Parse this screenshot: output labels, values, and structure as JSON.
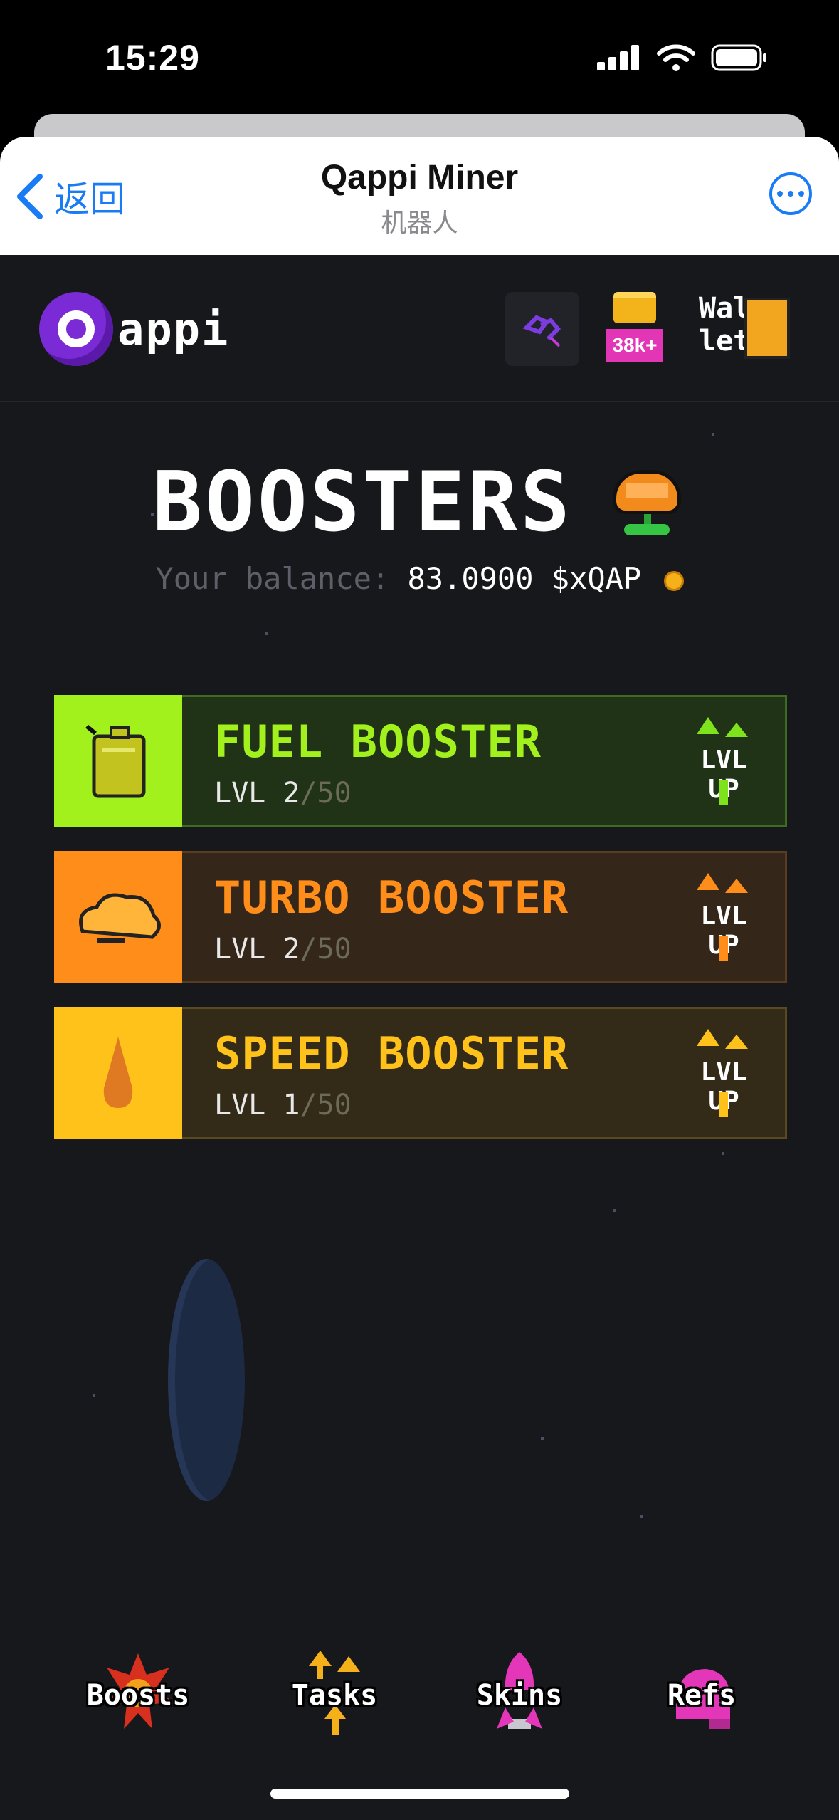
{
  "status_bar": {
    "time": "15:29"
  },
  "telegram_header": {
    "back_label": "返回",
    "title": "Qappi Miner",
    "subtitle": "机器人"
  },
  "app_bar": {
    "logo_text": "appi",
    "pot_badge": "38k+",
    "wallet_label_line1": "Wal",
    "wallet_label_line2": "let"
  },
  "page": {
    "title": "BOOSTERS",
    "balance_label": "Your balance:",
    "balance_value": "83.0900 $xQAP"
  },
  "boosters": [
    {
      "name": "FUEL BOOSTER",
      "lvl_prefix": "LVL 2",
      "lvl_max": "/50",
      "action": "LVL UP",
      "accent": "#a2f01c",
      "bg": "#213317",
      "border": "#3f6a22",
      "icon": "fuel-can-icon"
    },
    {
      "name": "TURBO BOOSTER",
      "lvl_prefix": "LVL 2",
      "lvl_max": "/50",
      "action": "LVL UP",
      "accent": "#ff8d1a",
      "bg": "#35261a",
      "border": "#5b3c20",
      "icon": "turbo-cloud-icon"
    },
    {
      "name": "SPEED BOOSTER",
      "lvl_prefix": "LVL 1",
      "lvl_max": "/50",
      "action": "LVL UP",
      "accent": "#ffc21a",
      "bg": "#332a18",
      "border": "#5b4a20",
      "icon": "flame-drop-icon"
    }
  ],
  "bottom_nav": [
    {
      "label": "Boosts",
      "icon": "explosion-icon"
    },
    {
      "label": "Tasks",
      "icon": "arrows-icon"
    },
    {
      "label": "Skins",
      "icon": "rocket-icon"
    },
    {
      "label": "Refs",
      "icon": "helmet-icon"
    }
  ]
}
